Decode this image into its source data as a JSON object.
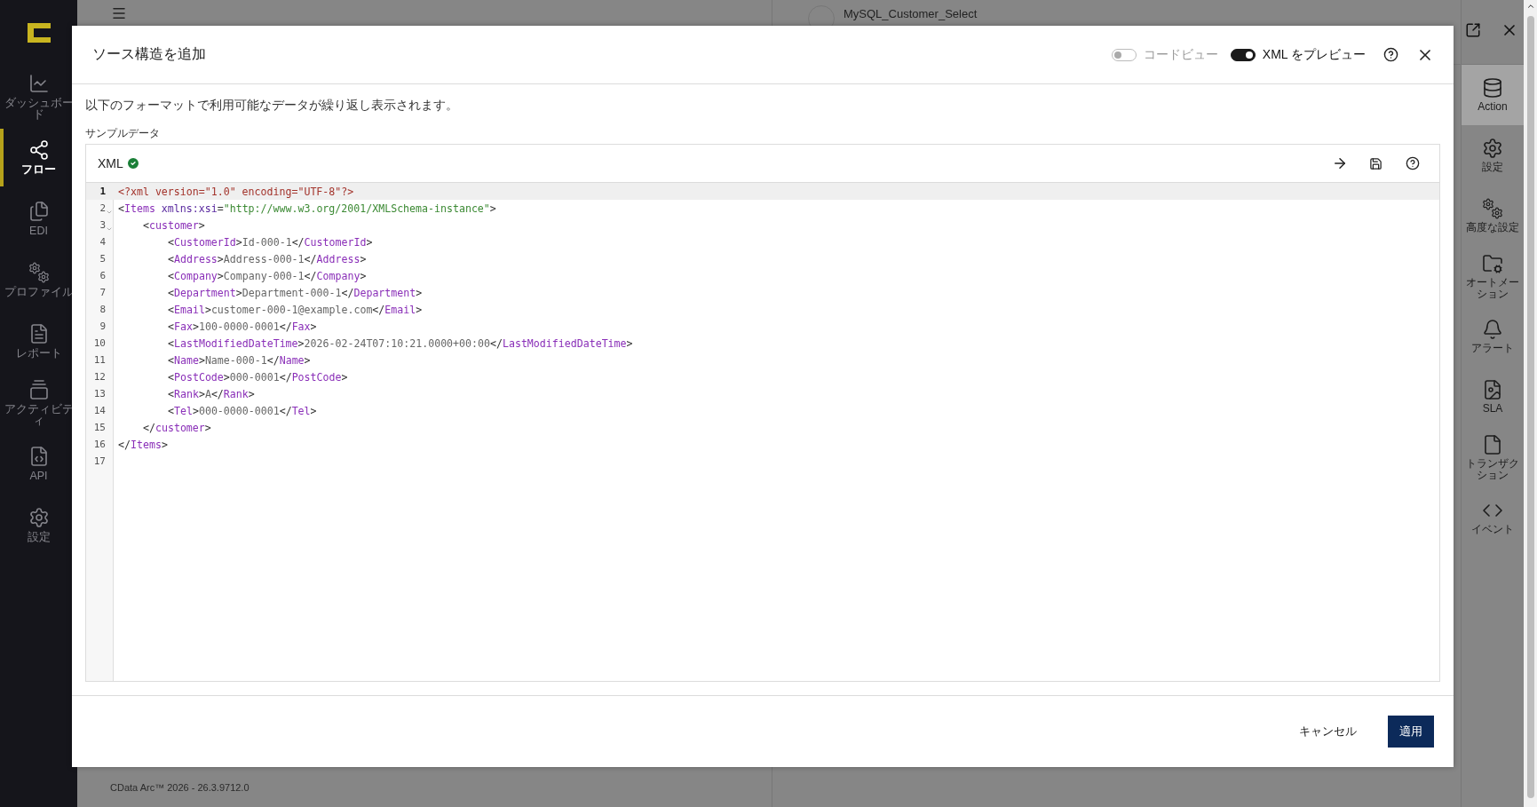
{
  "app": {
    "sidebar": {
      "items": [
        {
          "label": "ダッシュボード",
          "selected": false
        },
        {
          "label": "フロー",
          "selected": true
        },
        {
          "label": "EDI",
          "selected": false
        },
        {
          "label": "プロファイル",
          "selected": false
        },
        {
          "label": "レポート",
          "selected": false
        },
        {
          "label": "アクティビティ",
          "selected": false
        },
        {
          "label": "API",
          "selected": false
        },
        {
          "label": "設定",
          "selected": false
        }
      ]
    },
    "page_title": "MySQL_Customer_Select",
    "footer": "CData Arc™ 2026 - 26.3.9712.0",
    "side_panel": {
      "items": [
        {
          "label": "Action",
          "selected": true
        },
        {
          "label": "設定",
          "selected": false
        },
        {
          "label": "高度な設定",
          "selected": false
        },
        {
          "label": "オートメーション",
          "selected": false
        },
        {
          "label": "アラート",
          "selected": false
        },
        {
          "label": "SLA",
          "selected": false
        },
        {
          "label": "トランザクション",
          "selected": false
        },
        {
          "label": "イベント",
          "selected": false
        }
      ]
    }
  },
  "dialog": {
    "title": "ソース構造を追加",
    "toggles": [
      {
        "label": "コードビュー",
        "on": false
      },
      {
        "label": "XML をプレビュー",
        "on": true
      }
    ],
    "description": "以下のフォーマットで利用可能なデータが繰り返し表示されます。",
    "sample_label": "サンプルデータ",
    "editor": {
      "format": "XML",
      "valid": true,
      "lines": [
        {
          "number": "1",
          "active": true,
          "foldable": false,
          "tokens": [
            {
              "kind": "decl",
              "text": "<?xml version=\"1.0\" encoding=\"UTF-8\"?>"
            }
          ]
        },
        {
          "number": "2",
          "active": false,
          "foldable": true,
          "tokens": [
            {
              "kind": "bracket",
              "text": "<"
            },
            {
              "kind": "tag",
              "text": "Items"
            },
            {
              "kind": "attr",
              "text": " xmlns:xsi"
            },
            {
              "kind": "bracket",
              "text": "="
            },
            {
              "kind": "string",
              "text": "\"http://www.w3.org/2001/XMLSchema-instance\""
            },
            {
              "kind": "bracket",
              "text": ">"
            }
          ],
          "children": [
            {
              "number": "3",
              "active": false,
              "foldable": true,
              "tokens": [
                {
                  "kind": "bracket",
                  "text": "<"
                },
                {
                  "kind": "tag",
                  "text": "customer"
                },
                {
                  "kind": "bracket",
                  "text": ">"
                }
              ],
              "children": [
                {
                  "number": "4",
                  "active": false,
                  "foldable": false,
                  "tokens": [
                    {
                      "kind": "bracket",
                      "text": "<"
                    },
                    {
                      "kind": "tag",
                      "text": "CustomerId"
                    },
                    {
                      "kind": "bracket",
                      "text": ">"
                    },
                    {
                      "kind": "text",
                      "text": "Id-000-1"
                    },
                    {
                      "kind": "bracket",
                      "text": "</"
                    },
                    {
                      "kind": "tag",
                      "text": "CustomerId"
                    },
                    {
                      "kind": "bracket",
                      "text": ">"
                    }
                  ]
                },
                {
                  "number": "5",
                  "active": false,
                  "foldable": false,
                  "tokens": [
                    {
                      "kind": "bracket",
                      "text": "<"
                    },
                    {
                      "kind": "tag",
                      "text": "Address"
                    },
                    {
                      "kind": "bracket",
                      "text": ">"
                    },
                    {
                      "kind": "text",
                      "text": "Address-000-1"
                    },
                    {
                      "kind": "bracket",
                      "text": "</"
                    },
                    {
                      "kind": "tag",
                      "text": "Address"
                    },
                    {
                      "kind": "bracket",
                      "text": ">"
                    }
                  ]
                },
                {
                  "number": "6",
                  "active": false,
                  "foldable": false,
                  "tokens": [
                    {
                      "kind": "bracket",
                      "text": "<"
                    },
                    {
                      "kind": "tag",
                      "text": "Company"
                    },
                    {
                      "kind": "bracket",
                      "text": ">"
                    },
                    {
                      "kind": "text",
                      "text": "Company-000-1"
                    },
                    {
                      "kind": "bracket",
                      "text": "</"
                    },
                    {
                      "kind": "tag",
                      "text": "Company"
                    },
                    {
                      "kind": "bracket",
                      "text": ">"
                    }
                  ]
                },
                {
                  "number": "7",
                  "active": false,
                  "foldable": false,
                  "tokens": [
                    {
                      "kind": "bracket",
                      "text": "<"
                    },
                    {
                      "kind": "tag",
                      "text": "Department"
                    },
                    {
                      "kind": "bracket",
                      "text": ">"
                    },
                    {
                      "kind": "text",
                      "text": "Department-000-1"
                    },
                    {
                      "kind": "bracket",
                      "text": "</"
                    },
                    {
                      "kind": "tag",
                      "text": "Department"
                    },
                    {
                      "kind": "bracket",
                      "text": ">"
                    }
                  ]
                },
                {
                  "number": "8",
                  "active": false,
                  "foldable": false,
                  "tokens": [
                    {
                      "kind": "bracket",
                      "text": "<"
                    },
                    {
                      "kind": "tag",
                      "text": "Email"
                    },
                    {
                      "kind": "bracket",
                      "text": ">"
                    },
                    {
                      "kind": "text",
                      "text": "customer-000-1@example.com"
                    },
                    {
                      "kind": "bracket",
                      "text": "</"
                    },
                    {
                      "kind": "tag",
                      "text": "Email"
                    },
                    {
                      "kind": "bracket",
                      "text": ">"
                    }
                  ]
                },
                {
                  "number": "9",
                  "active": false,
                  "foldable": false,
                  "tokens": [
                    {
                      "kind": "bracket",
                      "text": "<"
                    },
                    {
                      "kind": "tag",
                      "text": "Fax"
                    },
                    {
                      "kind": "bracket",
                      "text": ">"
                    },
                    {
                      "kind": "text",
                      "text": "100-0000-0001"
                    },
                    {
                      "kind": "bracket",
                      "text": "</"
                    },
                    {
                      "kind": "tag",
                      "text": "Fax"
                    },
                    {
                      "kind": "bracket",
                      "text": ">"
                    }
                  ]
                },
                {
                  "number": "10",
                  "active": false,
                  "foldable": false,
                  "tokens": [
                    {
                      "kind": "bracket",
                      "text": "<"
                    },
                    {
                      "kind": "tag",
                      "text": "LastModifiedDateTime"
                    },
                    {
                      "kind": "bracket",
                      "text": ">"
                    },
                    {
                      "kind": "text",
                      "text": "2026-02-24T07:10:21.0000+00:00"
                    },
                    {
                      "kind": "bracket",
                      "text": "</"
                    },
                    {
                      "kind": "tag",
                      "text": "LastModifiedDateTime"
                    },
                    {
                      "kind": "bracket",
                      "text": ">"
                    }
                  ]
                },
                {
                  "number": "11",
                  "active": false,
                  "foldable": false,
                  "tokens": [
                    {
                      "kind": "bracket",
                      "text": "<"
                    },
                    {
                      "kind": "tag",
                      "text": "Name"
                    },
                    {
                      "kind": "bracket",
                      "text": ">"
                    },
                    {
                      "kind": "text",
                      "text": "Name-000-1"
                    },
                    {
                      "kind": "bracket",
                      "text": "</"
                    },
                    {
                      "kind": "tag",
                      "text": "Name"
                    },
                    {
                      "kind": "bracket",
                      "text": ">"
                    }
                  ]
                },
                {
                  "number": "12",
                  "active": false,
                  "foldable": false,
                  "tokens": [
                    {
                      "kind": "bracket",
                      "text": "<"
                    },
                    {
                      "kind": "tag",
                      "text": "PostCode"
                    },
                    {
                      "kind": "bracket",
                      "text": ">"
                    },
                    {
                      "kind": "text",
                      "text": "000-0001"
                    },
                    {
                      "kind": "bracket",
                      "text": "</"
                    },
                    {
                      "kind": "tag",
                      "text": "PostCode"
                    },
                    {
                      "kind": "bracket",
                      "text": ">"
                    }
                  ]
                },
                {
                  "number": "13",
                  "active": false,
                  "foldable": false,
                  "tokens": [
                    {
                      "kind": "bracket",
                      "text": "<"
                    },
                    {
                      "kind": "tag",
                      "text": "Rank"
                    },
                    {
                      "kind": "bracket",
                      "text": ">"
                    },
                    {
                      "kind": "text",
                      "text": "A"
                    },
                    {
                      "kind": "bracket",
                      "text": "</"
                    },
                    {
                      "kind": "tag",
                      "text": "Rank"
                    },
                    {
                      "kind": "bracket",
                      "text": ">"
                    }
                  ]
                },
                {
                  "number": "14",
                  "active": false,
                  "foldable": false,
                  "tokens": [
                    {
                      "kind": "bracket",
                      "text": "<"
                    },
                    {
                      "kind": "tag",
                      "text": "Tel"
                    },
                    {
                      "kind": "bracket",
                      "text": ">"
                    },
                    {
                      "kind": "text",
                      "text": "000-0000-0001"
                    },
                    {
                      "kind": "bracket",
                      "text": "</"
                    },
                    {
                      "kind": "tag",
                      "text": "Tel"
                    },
                    {
                      "kind": "bracket",
                      "text": ">"
                    }
                  ]
                }
              ]
            },
            {
              "number": "15",
              "active": false,
              "foldable": false,
              "tokens": [
                {
                  "kind": "bracket",
                  "text": "</"
                },
                {
                  "kind": "tag",
                  "text": "customer"
                },
                {
                  "kind": "bracket",
                  "text": ">"
                }
              ]
            }
          ]
        },
        {
          "number": "16",
          "active": false,
          "foldable": false,
          "tokens": [
            {
              "kind": "bracket",
              "text": "</"
            },
            {
              "kind": "tag",
              "text": "Items"
            },
            {
              "kind": "bracket",
              "text": ">"
            }
          ]
        },
        {
          "number": "17",
          "active": false,
          "foldable": false
        }
      ]
    },
    "buttons": [
      {
        "label": "キャンセル",
        "kind": "text"
      },
      {
        "label": "適用",
        "kind": "primary"
      }
    ]
  }
}
